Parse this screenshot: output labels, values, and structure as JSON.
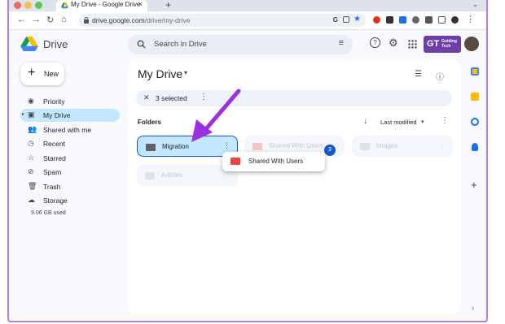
{
  "browser": {
    "tab_title": "My Drive - Google Drive",
    "tab_close": "×",
    "new_tab": "+",
    "tab_chevron": "⌄",
    "url_host": "drive.google.com",
    "url_path": "/drive/my-drive",
    "nav": {
      "back": "←",
      "forward": "→",
      "reload": "↻",
      "home": "⌂"
    }
  },
  "header": {
    "brand": "Drive",
    "search_placeholder": "Search in Drive",
    "filter_icon": "≡",
    "help_icon": "?",
    "settings_icon": "⚙",
    "apps_icon": "⋮⋮⋮",
    "badge_text": "GT",
    "badge_subtext": "Guiding Tech"
  },
  "sidebar": {
    "new_label": "New",
    "new_plus": "+",
    "items": [
      {
        "label": "Priority",
        "icon": "◉"
      },
      {
        "label": "My Drive",
        "icon": "▣"
      },
      {
        "label": "Shared with me",
        "icon": "👥"
      },
      {
        "label": "Recent",
        "icon": "◷"
      },
      {
        "label": "Starred",
        "icon": "☆"
      },
      {
        "label": "Spam",
        "icon": "⊘"
      },
      {
        "label": "Trash",
        "icon": "🗑"
      },
      {
        "label": "Storage",
        "icon": "☁"
      }
    ],
    "storage_used": "9.06 GB used"
  },
  "main": {
    "title": "My Drive",
    "title_caret": "▾",
    "list_icon": "☰",
    "info_icon": "ⓘ",
    "selection": {
      "close": "✕",
      "count_text": "3 selected",
      "more": "⋮"
    },
    "folders_label": "Folders",
    "sort": {
      "arrow": "↓",
      "label": "Last modified",
      "caret": "▾",
      "more": "⋮"
    },
    "folders": [
      {
        "name": "Migration",
        "more": "⋮"
      },
      {
        "name": "Shared With Users",
        "more": "⋮"
      },
      {
        "name": "Images",
        "more": "⋮"
      },
      {
        "name": "Articles",
        "more": "⋮"
      }
    ],
    "drag_ghost": {
      "name": "Shared With Users",
      "count": "3"
    }
  },
  "side_panel": {
    "add": "+",
    "collapse": "›"
  },
  "colors": {
    "accent_blue": "#0b57d0",
    "selected_bg": "#c2e7ff",
    "frame": "#b77bd9",
    "arrow": "#9b30e0",
    "folder_red": "#e8453c"
  }
}
